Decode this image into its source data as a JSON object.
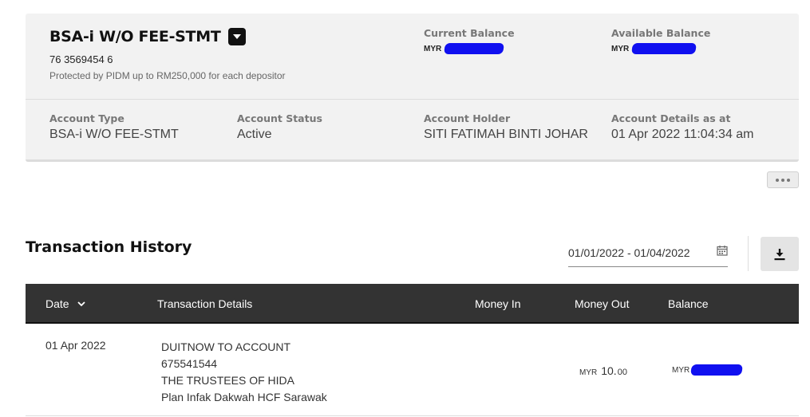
{
  "account": {
    "name": "BSA-i W/O FEE-STMT",
    "number": "76 3569454 6",
    "protection": "Protected by PIDM up to RM250,000 for each depositor",
    "current_balance": {
      "label": "Current Balance",
      "currency": "MYR"
    },
    "available_balance": {
      "label": "Available Balance",
      "currency": "MYR"
    },
    "details": [
      {
        "label": "Account Type",
        "value": "BSA-i W/O FEE-STMT"
      },
      {
        "label": "Account Status",
        "value": "Active"
      },
      {
        "label": "Account Holder",
        "value": "SITI FATIMAH BINTI JOHAR"
      },
      {
        "label": "Account Details as at",
        "value": "01 Apr 2022 11:04:34 am"
      }
    ]
  },
  "transactions": {
    "title": "Transaction History",
    "date_range": "01/01/2022 - 01/04/2022",
    "columns": {
      "date": "Date",
      "details": "Transaction Details",
      "money_in": "Money In",
      "money_out": "Money Out",
      "balance": "Balance"
    },
    "rows": [
      {
        "date": "01 Apr 2022",
        "details": [
          "DUITNOW TO ACCOUNT",
          "675541544",
          "THE TRUSTEES OF HIDA",
          "Plan Infak Dakwah HCF Sarawak"
        ],
        "money_out": {
          "currency": "MYR",
          "amount": "10.",
          "cents": "00"
        },
        "balance": {
          "currency": "MYR"
        }
      }
    ]
  },
  "colors": {
    "card_bg": "#f2f2f2",
    "table_header_bg": "#333333",
    "redaction": "#1010f0"
  },
  "icons": [
    "caret-down-icon",
    "more-icon",
    "calendar-icon",
    "download-icon",
    "sort-chevron-icon"
  ]
}
